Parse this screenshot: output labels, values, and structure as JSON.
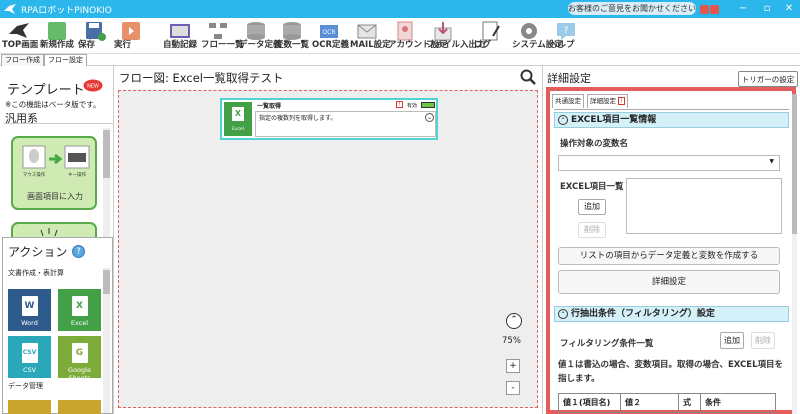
{
  "window": {
    "title": "RPAロボットPINOKIO",
    "feedback": "お客様のご意見をお聞かせください",
    "accent": "#2bb6ec"
  },
  "toolbar": [
    {
      "label": "TOP画面",
      "icon": "top-screen-icon"
    },
    {
      "label": "新規作成",
      "icon": "new-file-icon"
    },
    {
      "label": "保存",
      "icon": "save-icon"
    },
    {
      "label": "実行",
      "icon": "run-icon"
    },
    {
      "label": "自動記録",
      "icon": "record-icon"
    },
    {
      "label": "フロー一覧",
      "icon": "flow-list-icon"
    },
    {
      "label": "データ定義",
      "icon": "data-definition-icon"
    },
    {
      "label": "変数一覧",
      "icon": "variable-list-icon"
    },
    {
      "label": "OCR定義",
      "icon": "ocr-icon"
    },
    {
      "label": "MAIL設定",
      "icon": "mail-icon"
    },
    {
      "label": "アカウント設定",
      "icon": "account-icon"
    },
    {
      "label": "ファイル入出力",
      "icon": "file-io-icon"
    },
    {
      "label": "ログ",
      "icon": "log-icon"
    },
    {
      "label": "システム設定",
      "icon": "system-settings-icon"
    },
    {
      "label": "ヘルプ",
      "icon": "help-icon"
    }
  ],
  "tabs": {
    "flow_create": "フロー作成",
    "flow_settings": "フロー設定"
  },
  "template": {
    "title": "テンプレート",
    "new_badge": "NEW",
    "beta_note": "※この機能はベータ版です。",
    "category": "汎用系",
    "card1_caption": "画面項目に入力",
    "card1_mouse": "マウス操作",
    "card1_key": "キー操作"
  },
  "actions": {
    "title": "アクション",
    "help": "?",
    "section1": "文書作成・表計算",
    "section2": "データ管理",
    "tiles": [
      {
        "label": "Word",
        "letter": "W",
        "color": "#2f5b8c"
      },
      {
        "label": "Excel",
        "letter": "X",
        "color": "#43a047"
      },
      {
        "label": "CSV",
        "letter": "CSV",
        "color": "#2aa7b8"
      },
      {
        "label": "Google Sheets",
        "letter": "G",
        "color": "#7cab3a"
      }
    ]
  },
  "flow": {
    "title": "フロー図:  Excel一覧取得テスト",
    "node": {
      "icon_letter": "X",
      "icon_label": "Excel",
      "name": "一覧取得",
      "status": "有効",
      "description": "指定の複数列を取得します。"
    },
    "zoom": "75%",
    "zoom_in": "+",
    "zoom_out": "-"
  },
  "detail": {
    "title": "詳細設定",
    "trigger_button": "トリガーの設定",
    "tab_common": "共通設定",
    "tab_detail": "詳細設定",
    "section1": "EXCEL項目一覧情報",
    "target_var_label": "操作対象の変数名",
    "items_label": "EXCEL項目一覧",
    "add": "追加",
    "delete": "削除",
    "create_from_list": "リストの項目からデータ定義と変数を作成する",
    "detail_settings": "詳細設定",
    "section2": "行抽出条件（フィルタリング）設定",
    "filter_list_label": "フィルタリング条件一覧",
    "filter_add": "追加",
    "filter_delete": "削除",
    "note": "値１は書込の場合、変数項目。取得の場合、EXCEL項目を指します。",
    "table_headers": [
      "値１(項目名)",
      "値２",
      "式",
      "条件"
    ]
  }
}
